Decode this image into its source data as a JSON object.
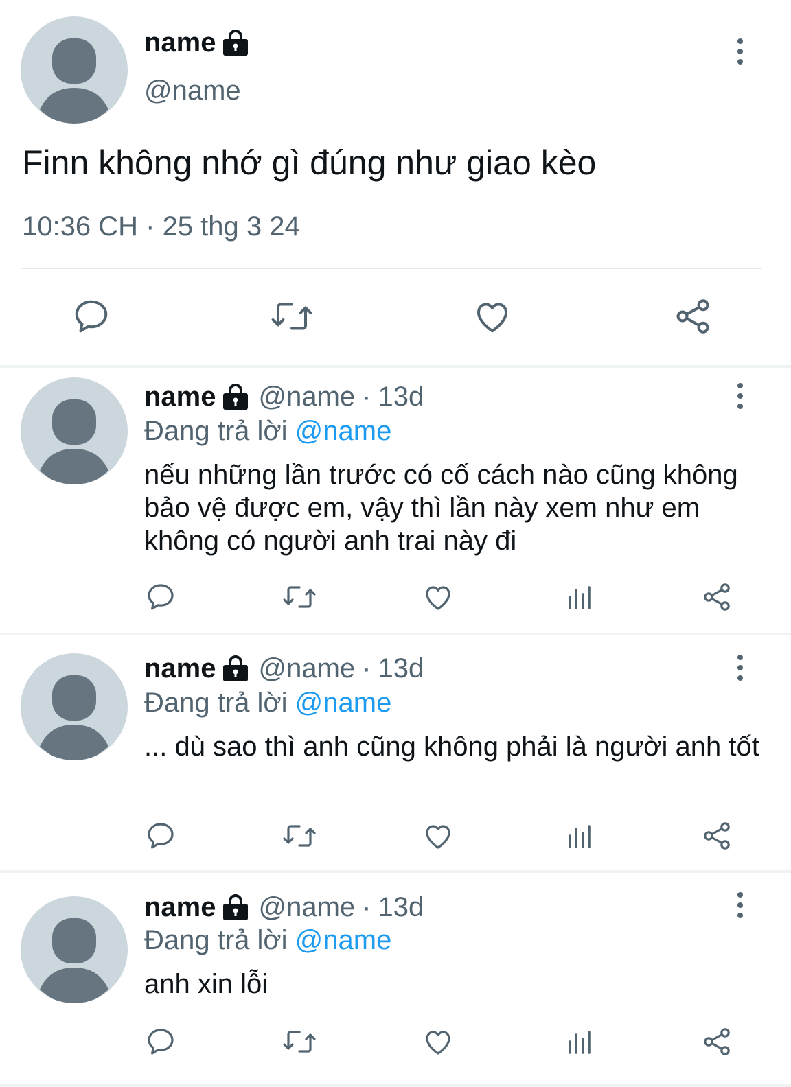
{
  "main_tweet": {
    "author_name": "name",
    "handle": "@name",
    "text": "Finn không nhớ gì đúng như giao kèo",
    "time": "10:36 CH",
    "dot": "·",
    "date": "25 thg 3 24",
    "actions": [
      "comment-icon",
      "retweet-icon",
      "like-icon",
      "share-icon"
    ]
  },
  "replies": [
    {
      "author_name": "name",
      "handle": "@name",
      "dot": "·",
      "age": "13d",
      "replying_prefix": "Đang trả lời",
      "replying_to": "@name",
      "text": "nếu những lần trước có cố cách nào cũng không bảo vệ được em, vậy thì lần này xem như em không có người anh trai này đi"
    },
    {
      "author_name": "name",
      "handle": "@name",
      "dot": "·",
      "age": "13d",
      "replying_prefix": "Đang trả lời",
      "replying_to": "@name",
      "text": "... dù sao thì anh cũng không phải là người anh tốt"
    },
    {
      "author_name": "name",
      "handle": "@name",
      "dot": "·",
      "age": "13d",
      "replying_prefix": "Đang trả lời",
      "replying_to": "@name",
      "text": "anh xin lỗi"
    }
  ],
  "colors": {
    "text": "#0f1419",
    "muted": "#536471",
    "link": "#1d9bf0",
    "avatar_bg": "#ccd6dd",
    "avatar_fg": "#66757f"
  }
}
